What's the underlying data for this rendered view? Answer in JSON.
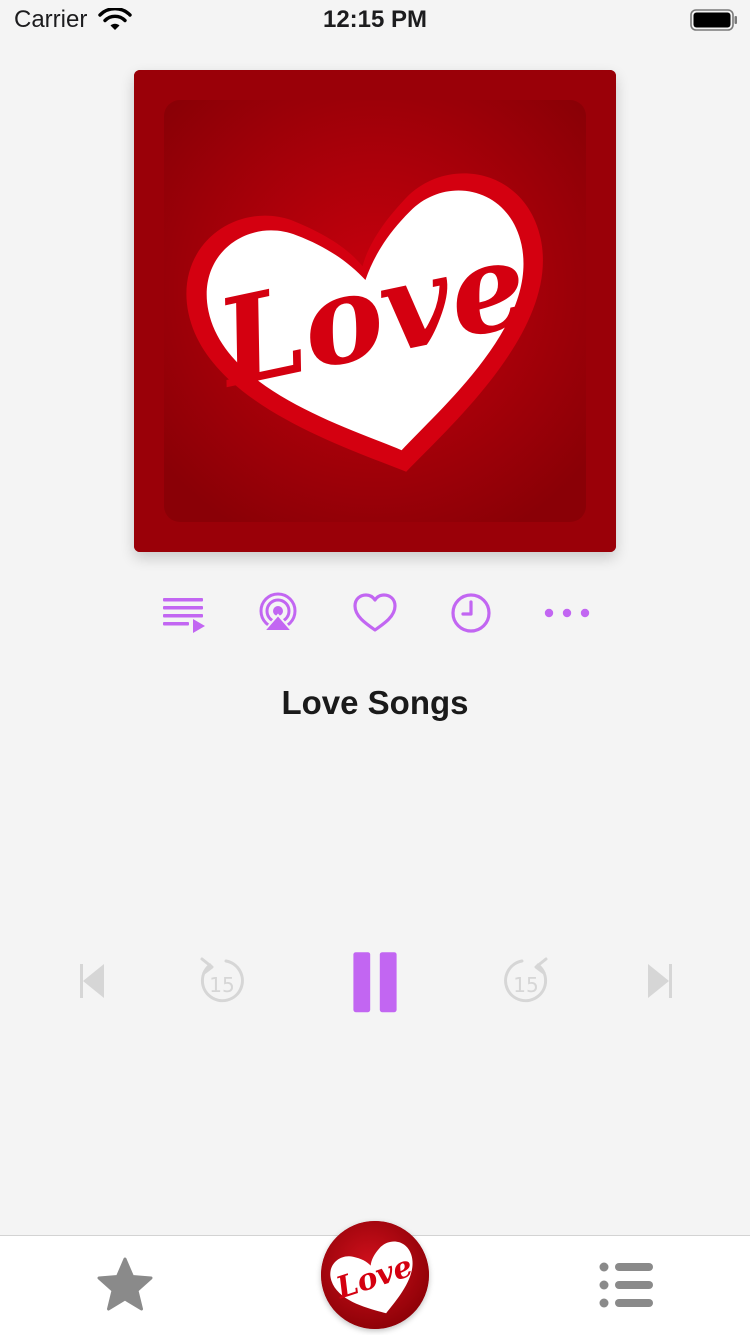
{
  "status_bar": {
    "carrier": "Carrier",
    "time": "12:15 PM"
  },
  "artwork": {
    "logo_text": "Love",
    "colors": {
      "background": "#9a0008",
      "heart": "#d0000f",
      "letters": "#ffffff"
    }
  },
  "actions": [
    {
      "name": "queue-icon"
    },
    {
      "name": "airplay-icon"
    },
    {
      "name": "heart-icon"
    },
    {
      "name": "sleep-timer-icon"
    },
    {
      "name": "more-icon"
    }
  ],
  "now_playing": {
    "title": "Love Songs"
  },
  "controls": {
    "skip_back_seconds": "15",
    "skip_forward_seconds": "15",
    "state": "playing"
  },
  "tab_bar": {
    "items": [
      {
        "name": "favorites-tab",
        "icon": "star-icon"
      },
      {
        "name": "home-tab",
        "icon": "love-logo"
      },
      {
        "name": "list-tab",
        "icon": "list-icon"
      }
    ]
  },
  "colors": {
    "accent": "#c266f2",
    "disabled": "#d6d6d6",
    "tab_icon": "#8a8a8a"
  }
}
